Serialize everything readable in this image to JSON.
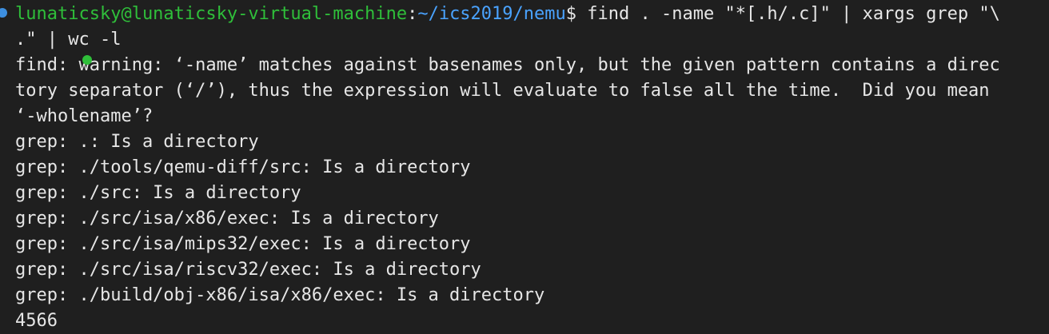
{
  "prompt": {
    "user_host": "lunaticsky@lunaticsky-virtual-machine",
    "colon": ":",
    "cwd": "~/ics2019/nemu",
    "symbol": "$",
    "command_line1": " find . -name \"*[.h/.c]\" | xargs grep \"\\",
    "command_line2": ".\" | wc -l"
  },
  "output": [
    "find: warning: ‘-name’ matches against basenames only, but the given pattern contains a direc",
    "tory separator (‘/’), thus the expression will evaluate to false all the time.  Did you mean",
    "‘-wholename’?",
    "grep: .: Is a directory",
    "grep: ./tools/qemu-diff/src: Is a directory",
    "grep: ./src: Is a directory",
    "grep: ./src/isa/x86/exec: Is a directory",
    "grep: ./src/isa/mips32/exec: Is a directory",
    "grep: ./src/isa/riscv32/exec: Is a directory",
    "grep: ./build/obj-x86/isa/x86/exec: Is a directory",
    "4566"
  ],
  "colors": {
    "background": "#1f1f1f",
    "text": "#e6e6e6",
    "user_host": "#2fbf3a",
    "path": "#4aa3ff",
    "status_dot_blue": "#3d8fe0",
    "cursor_dot_green": "#2fbf3a"
  }
}
